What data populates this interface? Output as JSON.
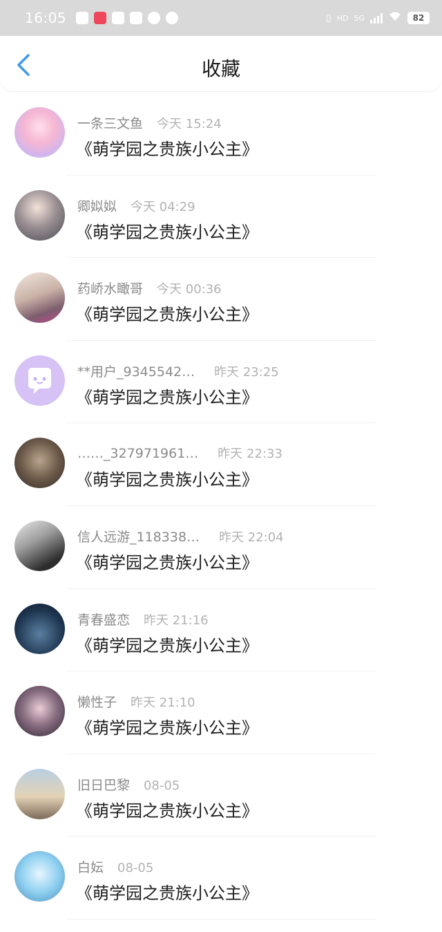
{
  "status_bar": {
    "time": "16:05",
    "hd_label": "HD",
    "network_label": "5G",
    "battery": "82"
  },
  "nav": {
    "title": "收藏"
  },
  "items": [
    {
      "username": "一条三文鱼",
      "time": "今天 15:24",
      "book": "《萌学园之贵族小公主》"
    },
    {
      "username": "卿姒姒",
      "time": "今天 04:29",
      "book": "《萌学园之贵族小公主》"
    },
    {
      "username": "药峤水瞰哥",
      "time": "今天 00:36",
      "book": "《萌学园之贵族小公主》"
    },
    {
      "username": "**用户_9345542…",
      "time": "昨天 23:25",
      "book": "《萌学园之贵族小公主》"
    },
    {
      "username": "……_327971961…",
      "time": "昨天 22:33",
      "book": "《萌学园之贵族小公主》"
    },
    {
      "username": "信人远游_118338…",
      "time": "昨天 22:04",
      "book": "《萌学园之贵族小公主》"
    },
    {
      "username": "青春盛恋",
      "time": "昨天 21:16",
      "book": "《萌学园之贵族小公主》"
    },
    {
      "username": "懒性子",
      "time": "昨天 21:10",
      "book": "《萌学园之贵族小公主》"
    },
    {
      "username": "旧日巴黎",
      "time": "08-05",
      "book": "《萌学园之贵族小公主》"
    },
    {
      "username": "白妘",
      "time": "08-05",
      "book": "《萌学园之贵族小公主》"
    }
  ],
  "colors": {
    "accent": "#3d9ae8",
    "status_bar_bg": "#d9d9d9",
    "default_avatar_bg": "#d6c2f5"
  }
}
